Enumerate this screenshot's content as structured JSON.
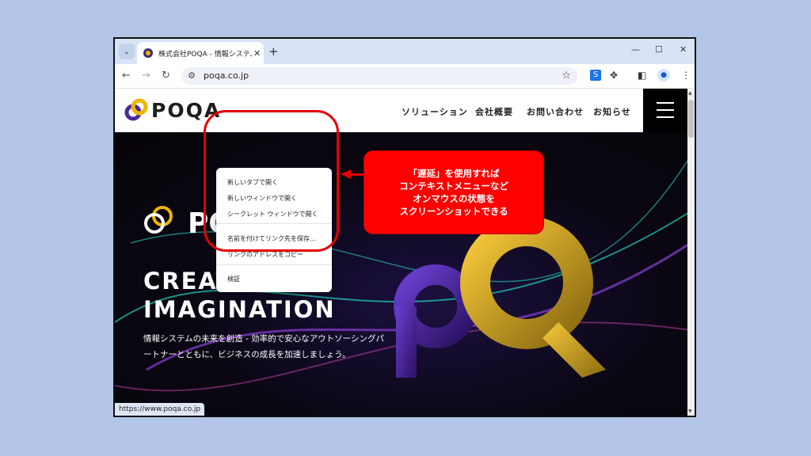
{
  "browser": {
    "tab_title": "株式会社POQA - 情報システムの…",
    "url": "poqa.co.jp",
    "status_url": "https://www.poqa.co.jp"
  },
  "site": {
    "logo_text": "POQA",
    "nav": [
      "ソリューション",
      "会社概要",
      "お問い合わせ",
      "お知らせ"
    ],
    "hero_logo_text": "PO",
    "hero_title_line1": "CREATION &",
    "hero_title_line2": "IMAGINATION",
    "hero_sub_line1": "情報システムの未来を創造 - 効率的で安心なアウトソーシングパ",
    "hero_sub_line2": "ートナーとともに、ビジネスの成長を加速しましょう。"
  },
  "context_menu": {
    "items": [
      "新しいタブで開く",
      "新しいウィンドウで開く",
      "シークレット ウィンドウで開く",
      "名前を付けてリンク先を保存...",
      "リンクのアドレスをコピー",
      "検証"
    ]
  },
  "callout": {
    "lines": [
      "「遅延」を使用すれば",
      "コンテキストメニューなど",
      "オンマウスの状態を",
      "スクリーンショットできる"
    ]
  },
  "colors": {
    "annotation_red": "#ff0000",
    "background": "#b4c6e7",
    "brand_yellow": "#f0b400",
    "brand_purple": "#4b2a9a"
  }
}
